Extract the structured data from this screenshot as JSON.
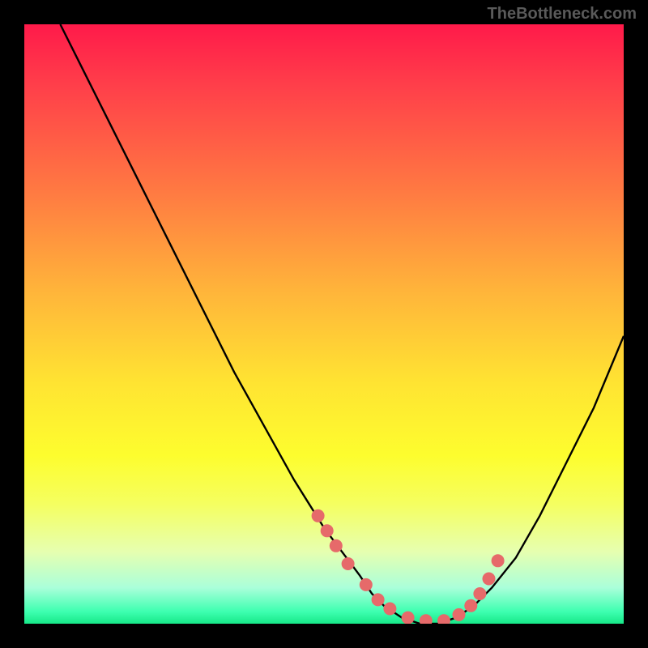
{
  "watermark": "TheBottleneck.com",
  "chart_data": {
    "type": "line",
    "title": "",
    "xlabel": "",
    "ylabel": "",
    "xlim": [
      0,
      100
    ],
    "ylim": [
      0,
      100
    ],
    "series": [
      {
        "name": "bottleneck-curve",
        "x": [
          6,
          10,
          15,
          20,
          25,
          30,
          35,
          40,
          45,
          50,
          53,
          56,
          58,
          60,
          63,
          66,
          69,
          72,
          75,
          78,
          82,
          86,
          90,
          95,
          100
        ],
        "y": [
          100,
          92,
          82,
          72,
          62,
          52,
          42,
          33,
          24,
          16,
          12,
          8,
          5,
          3,
          1,
          0,
          0,
          1,
          3,
          6,
          11,
          18,
          26,
          36,
          48
        ]
      }
    ],
    "markers": {
      "name": "highlight-points",
      "x": [
        49,
        50.5,
        52,
        54,
        57,
        59,
        61,
        64,
        67,
        70,
        72.5,
        74.5,
        76,
        77.5,
        79
      ],
      "y": [
        18,
        15.5,
        13,
        10,
        6.5,
        4,
        2.5,
        1,
        0.5,
        0.5,
        1.5,
        3,
        5,
        7.5,
        10.5
      ]
    },
    "gradient_stops": [
      {
        "pos": 0,
        "color": "#ff1a4a"
      },
      {
        "pos": 0.45,
        "color": "#ffb63a"
      },
      {
        "pos": 0.72,
        "color": "#fdfd2e"
      },
      {
        "pos": 1.0,
        "color": "#17e888"
      }
    ]
  }
}
